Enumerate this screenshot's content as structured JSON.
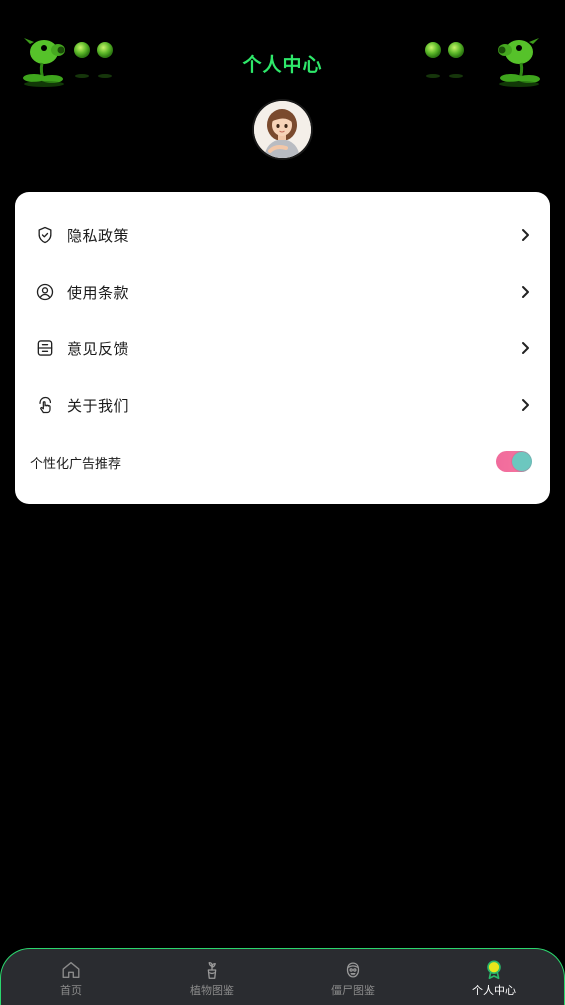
{
  "header": {
    "title": "个人中心"
  },
  "menu": {
    "items": [
      {
        "label": "隐私政策",
        "icon": "shield-check-icon"
      },
      {
        "label": "使用条款",
        "icon": "user-circle-icon"
      },
      {
        "label": "意见反馈",
        "icon": "inbox-icon"
      },
      {
        "label": "关于我们",
        "icon": "hand-pointer-icon"
      }
    ],
    "toggle": {
      "label": "个性化广告推荐",
      "state": "on"
    }
  },
  "nav": {
    "items": [
      {
        "label": "首页",
        "icon": "home-icon",
        "active": false
      },
      {
        "label": "植物图鉴",
        "icon": "plant-pot-icon",
        "active": false
      },
      {
        "label": "僵尸图鉴",
        "icon": "zombie-face-icon",
        "active": false
      },
      {
        "label": "个人中心",
        "icon": "profile-badge-icon",
        "active": true
      }
    ]
  },
  "colors": {
    "title_green": "#2ee86a",
    "nav_border": "#2bd66e",
    "toggle_pink": "#f06b9c",
    "toggle_teal": "#6cc7bf"
  }
}
